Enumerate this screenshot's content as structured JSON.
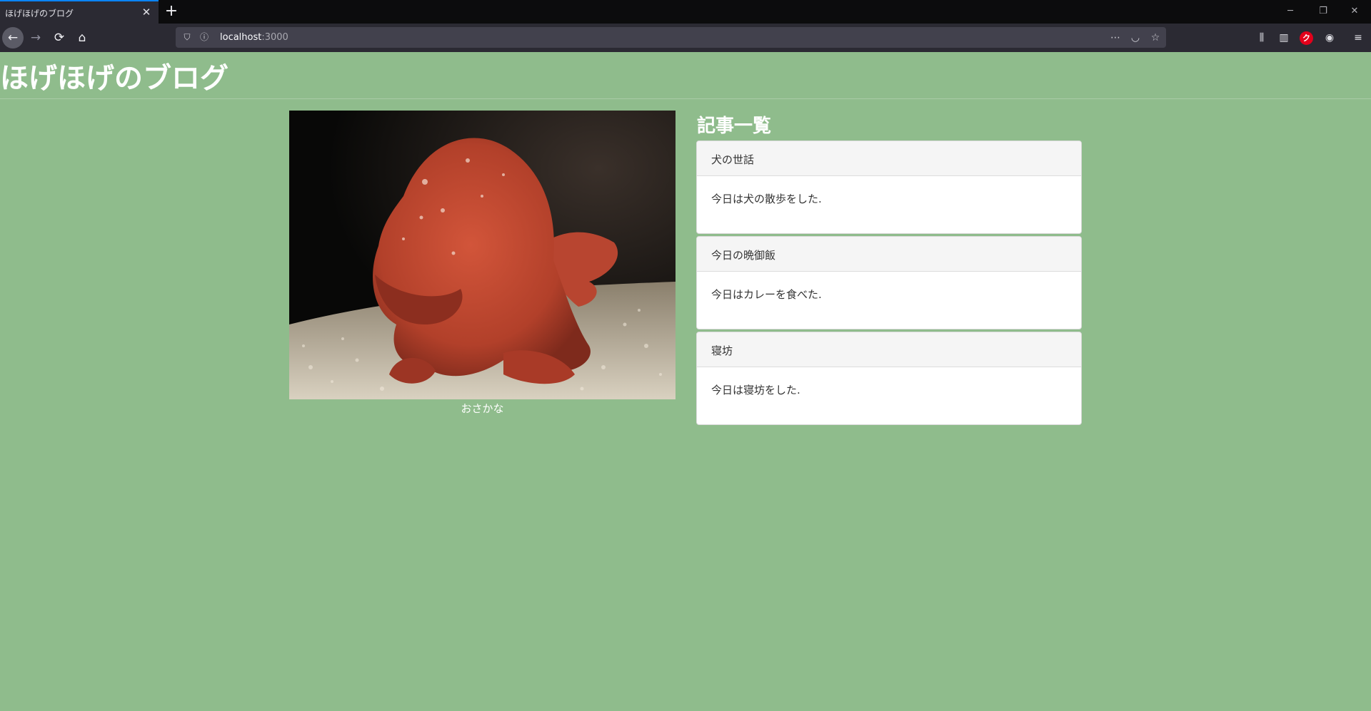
{
  "browser": {
    "tab_title": "ほげほげのブログ",
    "tab_close_icon": "close-icon",
    "new_tab_icon": "plus-icon",
    "url_host": "localhost",
    "url_port": ":3000",
    "window_controls": {
      "minimize": "─",
      "restore": "❐",
      "close": "✕"
    },
    "icons": {
      "back": "←",
      "forward": "→",
      "reload": "⟳",
      "home": "⌂",
      "shield": "⛉",
      "info": "ⓘ",
      "more": "⋯",
      "pocket": "◡",
      "bookmark": "☆",
      "library": "⫼",
      "sidebar": "▥",
      "account": "◉",
      "menu": "≡"
    }
  },
  "site": {
    "title": "ほげほげのブログ"
  },
  "photo": {
    "caption": "おさかな"
  },
  "articles": {
    "heading": "記事一覧",
    "items": [
      {
        "title": "犬の世話",
        "body": "今日は犬の散歩をした."
      },
      {
        "title": "今日の晩御飯",
        "body": "今日はカレーを食べた."
      },
      {
        "title": "寝坊",
        "body": "今日は寝坊をした."
      }
    ]
  }
}
